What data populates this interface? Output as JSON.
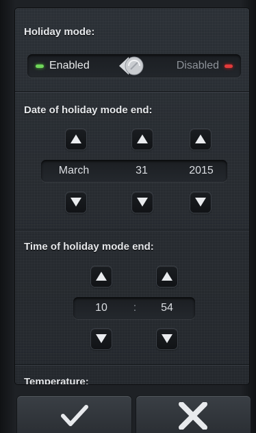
{
  "holiday_mode": {
    "title": "Holiday mode:",
    "enabled_label": "Enabled",
    "disabled_label": "Disabled",
    "state": "enabled"
  },
  "date_section": {
    "title": "Date of holiday mode end:",
    "month": "March",
    "day": "31",
    "year": "2015"
  },
  "time_section": {
    "title": "Time of holiday mode end:",
    "hour": "10",
    "separator": ":",
    "minute": "54"
  },
  "temperature_section": {
    "title": "Temperature:"
  },
  "icons": {
    "up": "up-arrow-icon",
    "down": "down-arrow-icon",
    "confirm": "checkmark-icon",
    "cancel": "close-icon"
  },
  "colors": {
    "enabled_led": "#6fd65a",
    "disabled_led": "#e23b3b",
    "panel": "#272b30"
  }
}
